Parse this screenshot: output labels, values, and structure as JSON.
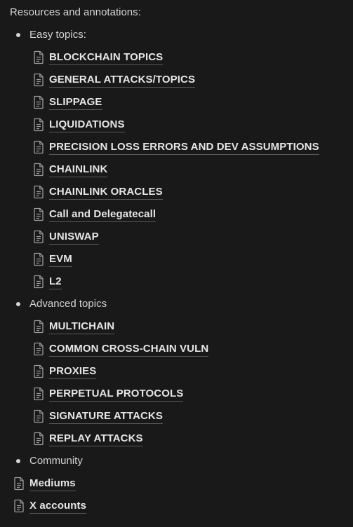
{
  "heading": "Resources and annotations:",
  "sections": {
    "easy": {
      "label": "Easy topics:",
      "items": [
        "BLOCKCHAIN TOPICS",
        "GENERAL ATTACKS/TOPICS",
        "SLIPPAGE",
        "LIQUIDATIONS",
        "PRECISION LOSS ERRORS AND DEV ASSUMPTIONS",
        "CHAINLINK",
        "CHAINLINK ORACLES",
        "Call and Delegatecall",
        "UNISWAP",
        "EVM",
        "L2"
      ]
    },
    "advanced": {
      "label": "Advanced topics",
      "items": [
        "MULTICHAIN",
        "COMMON CROSS-CHAIN VULN",
        "PROXIES",
        "PERPETUAL PROTOCOLS",
        "SIGNATURE ATTACKS",
        "REPLAY ATTACKS"
      ]
    },
    "community": {
      "label": "Community"
    }
  },
  "root_pages": [
    "Mediums",
    "X accounts"
  ],
  "icons": {
    "page": "page-icon"
  }
}
